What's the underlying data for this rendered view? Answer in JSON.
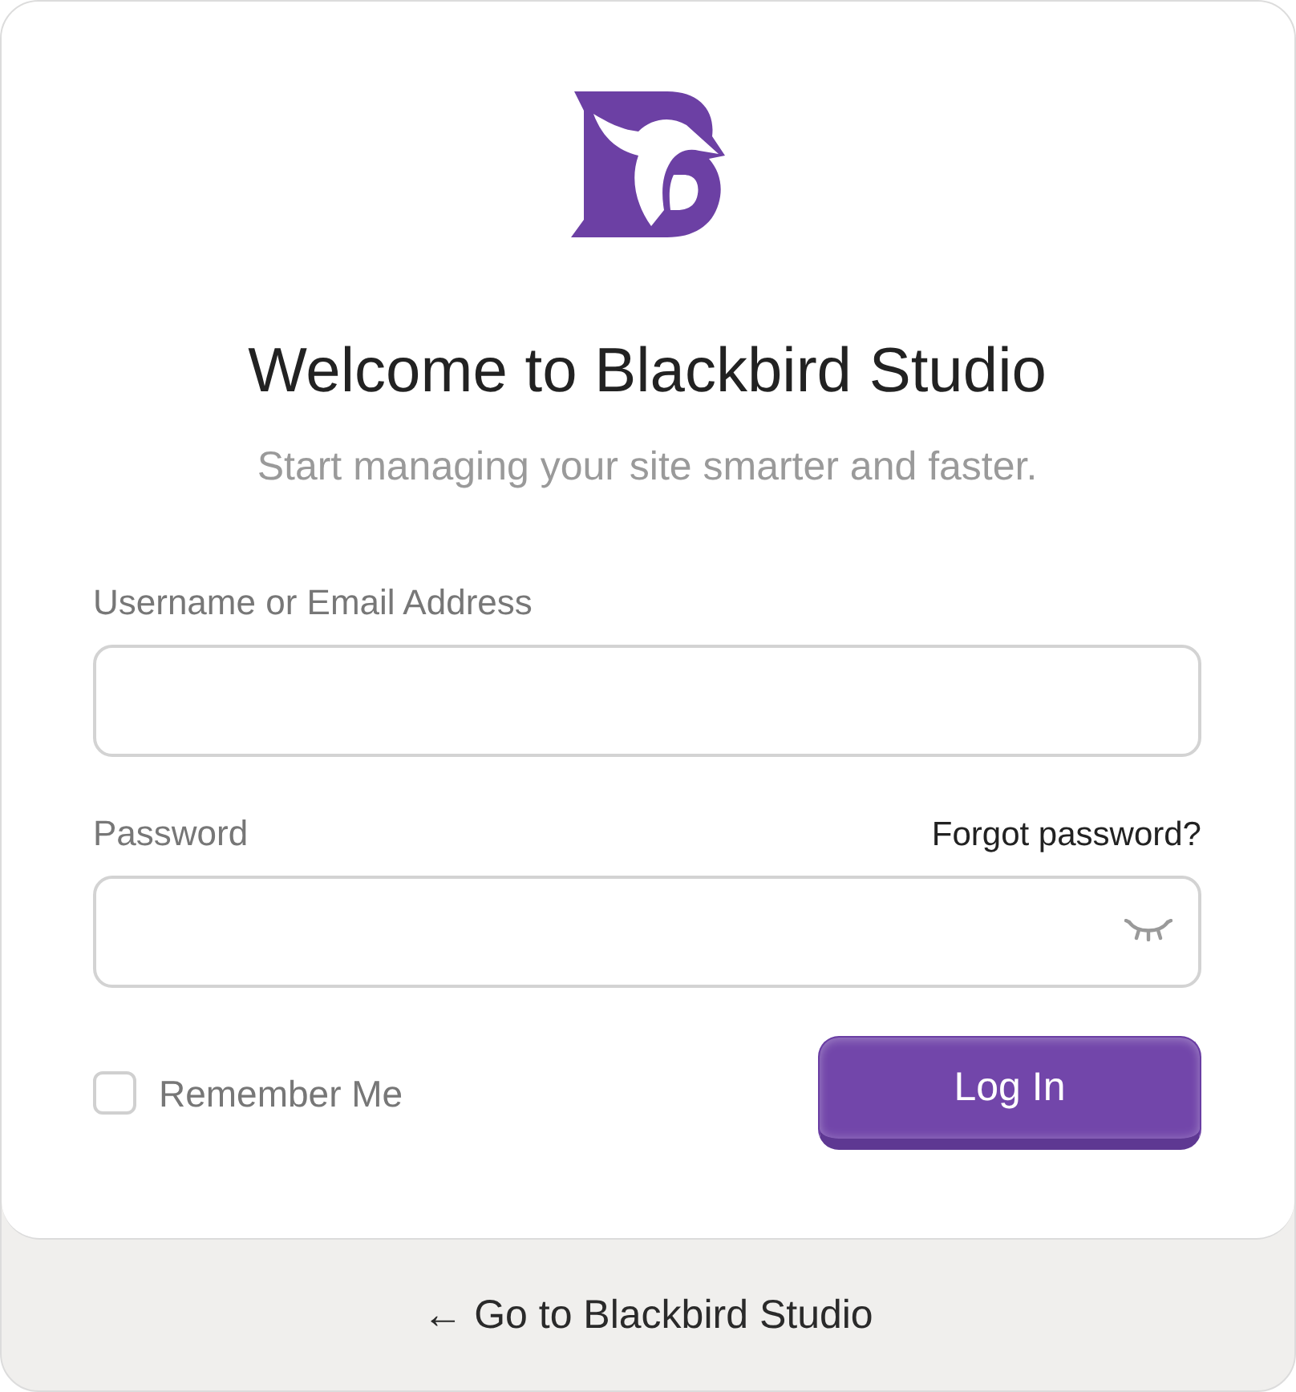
{
  "heading": "Welcome to Blackbird Studio",
  "subheading": "Start managing your site smarter and faster.",
  "fields": [
    {
      "kind": "text",
      "label": "Username or Email Address"
    },
    {
      "kind": "password",
      "label": "Password",
      "link": "Forgot password?",
      "visible": false
    }
  ],
  "remember": {
    "label": "Remember Me",
    "checked": false
  },
  "submit": "Log In",
  "back_link": "← Go to Blackbird Studio"
}
